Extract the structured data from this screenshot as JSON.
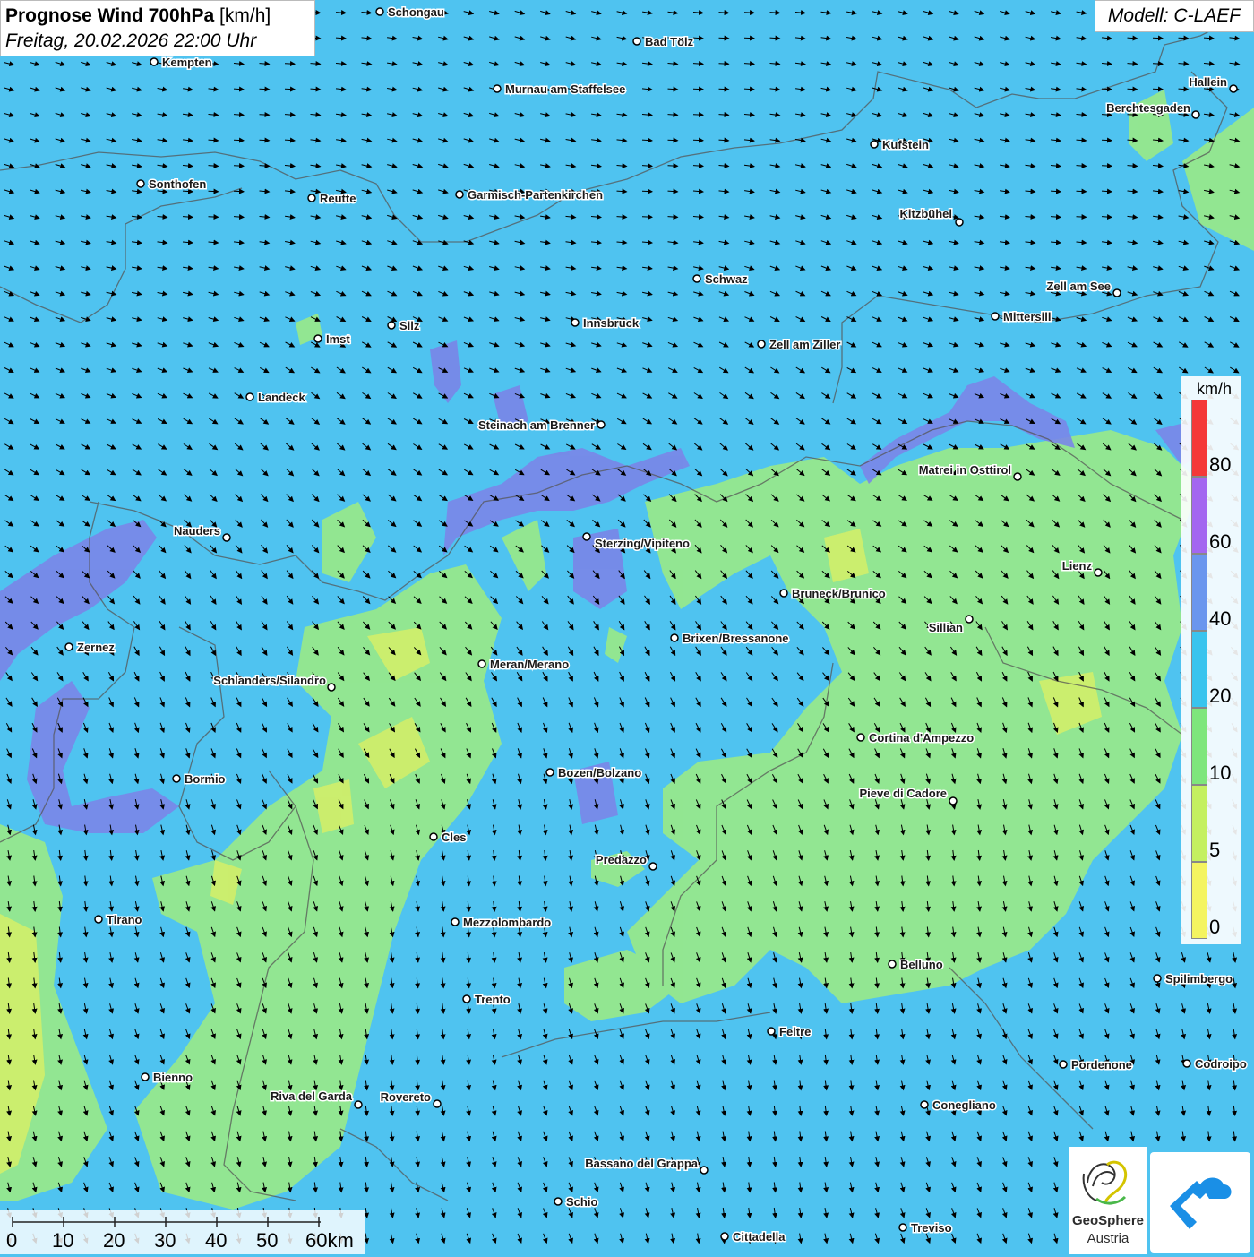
{
  "header": {
    "title_bold": "Prognose Wind 700hPa",
    "title_unit": "[km/h]",
    "datetime": "Freitag, 20.02.2026 22:00 Uhr"
  },
  "model_label": "Modell: C-LAEF",
  "legend": {
    "unit": "km/h",
    "ticks": [
      "80",
      "60",
      "40",
      "20",
      "10",
      "5",
      "0"
    ],
    "colors": [
      "#f43838",
      "#a366f0",
      "#6a96ee",
      "#39c4ee",
      "#7ee67c",
      "#c4f060",
      "#f4f460"
    ]
  },
  "scale": {
    "labels": [
      "0",
      "10",
      "20",
      "30",
      "40",
      "50",
      "60km"
    ]
  },
  "logo": {
    "name_line1": "GeoSphere",
    "name_line2": "Austria"
  },
  "cities": [
    "Schongau",
    "Bad Tölz",
    "Kempten",
    "Murnau am Staffelsee",
    "Hallein",
    "Berchtesgaden",
    "Kufstein",
    "Sonthofen",
    "Reutte",
    "Garmisch-Partenkirchen",
    "Kitzbühel",
    "Schwaz",
    "Zell am See",
    "Mittersill",
    "Imst",
    "Silz",
    "Innsbruck",
    "Zell am Ziller",
    "Landeck",
    "Steinach am Brenner",
    "Matrei in Osttirol",
    "Nauders",
    "Sterzing/Vipiteno",
    "Lienz",
    "Bruneck/Brunico",
    "Sillian",
    "Zernez",
    "Brixen/Bressanone",
    "Meran/Merano",
    "Schlanders/Silandro",
    "Cortina d'Ampezzo",
    "Bormio",
    "Bozen/Bolzano",
    "Pieve di Cadore",
    "Cles",
    "Predazzo",
    "Tirano",
    "Mezzolombardo",
    "Belluno",
    "Spilimbergo",
    "Trento",
    "Feltre",
    "Pordenone",
    "Codroipo",
    "Bienno",
    "Riva del Garda",
    "Rovereto",
    "Conegliano",
    "Bassano del Grappa",
    "Schio",
    "Treviso",
    "Cittadella"
  ]
}
